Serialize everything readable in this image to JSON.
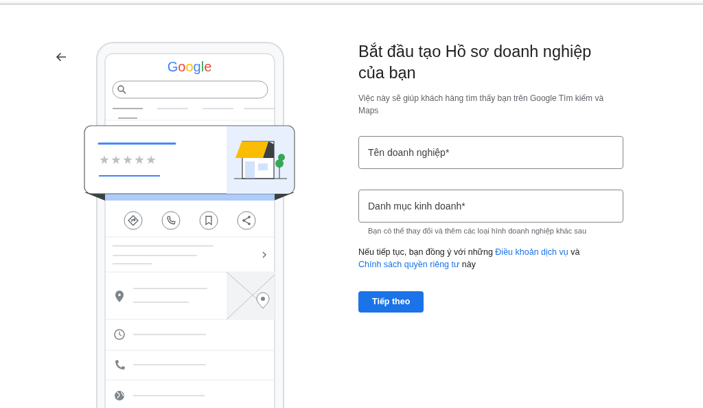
{
  "illustration": {
    "logo": "Google"
  },
  "title": "Bắt đầu tạo Hồ sơ doanh nghiệp của bạn",
  "subtitle": "Việc này sẽ giúp khách hàng tìm thấy bạn trên Google Tìm kiếm và Maps",
  "fields": [
    {
      "placeholder": "Tên doanh nghiệp*"
    },
    {
      "placeholder": "Danh mục kinh doanh*",
      "helper": "Bạn có thể thay đổi và thêm các loại hình doanh nghiệp khác sau"
    }
  ],
  "terms": [
    {
      "kind": "text",
      "text": "Nếu tiếp tục, bạn đồng ý với những "
    },
    {
      "kind": "link",
      "text": "Điều khoản dịch vụ"
    },
    {
      "kind": "text",
      "text": " và "
    },
    {
      "kind": "link",
      "text": "Chính sách quyền riêng tư"
    },
    {
      "kind": "text",
      "text": " này"
    }
  ],
  "next_button": "Tiếp theo"
}
